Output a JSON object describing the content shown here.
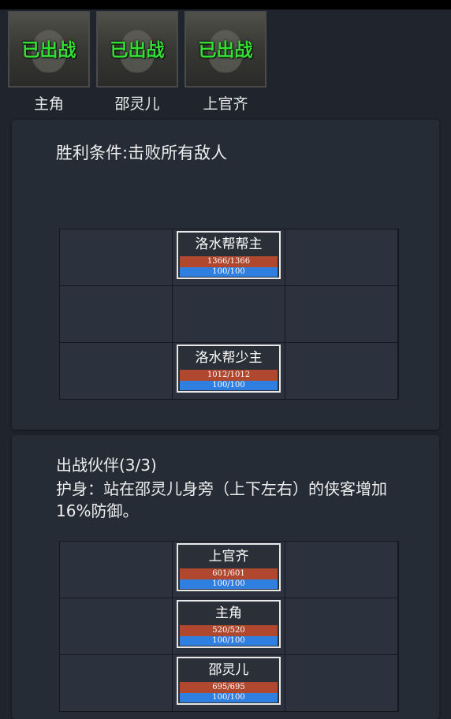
{
  "portraits": [
    {
      "badge": "已出战",
      "name": "主角"
    },
    {
      "badge": "已出战",
      "name": "邵灵儿"
    },
    {
      "badge": "已出战",
      "name": "上官齐"
    }
  ],
  "battle": {
    "victory_condition": "胜利条件:击败所有敌人",
    "enemies": [
      {
        "name": "洛水帮帮主",
        "hp": "1366/1366",
        "mp": "100/100"
      },
      {
        "name": "洛水帮少主",
        "hp": "1012/1012",
        "mp": "100/100"
      }
    ]
  },
  "partners": {
    "title": "出战伙伴(3/3)",
    "description": "护身：站在邵灵儿身旁（上下左右）的侠客增加16%防御。",
    "units": [
      {
        "name": "上官齐",
        "hp": "601/601",
        "mp": "100/100"
      },
      {
        "name": "主角",
        "hp": "520/520",
        "mp": "100/100"
      },
      {
        "name": "邵灵儿",
        "hp": "695/695",
        "mp": "100/100"
      }
    ]
  },
  "colors": {
    "badge_green": "#33dd33",
    "hp_bar": "#b0472f",
    "mp_bar": "#2f7fe0",
    "background": "#1f242d"
  }
}
